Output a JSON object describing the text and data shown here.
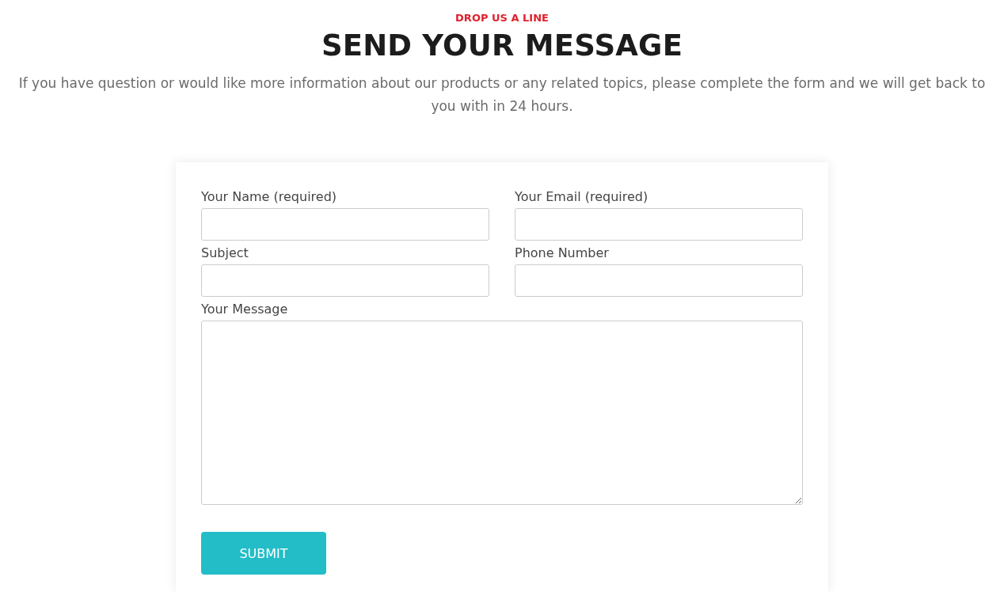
{
  "eyebrow": "DROP US A LINE",
  "title": "SEND YOUR MESSAGE",
  "intro": "If you have question or would like more information about our products or any related topics, please complete the form and we will get back to you with in 24 hours.",
  "form": {
    "fields": [
      {
        "kind": "text",
        "label": "Your Name (required)"
      },
      {
        "kind": "text",
        "label": "Your Email (required)"
      },
      {
        "kind": "text",
        "label": "Subject"
      },
      {
        "kind": "text",
        "label": "Phone Number"
      },
      {
        "kind": "textarea",
        "label": "Your Message"
      }
    ],
    "submit": "SUBMIT"
  }
}
